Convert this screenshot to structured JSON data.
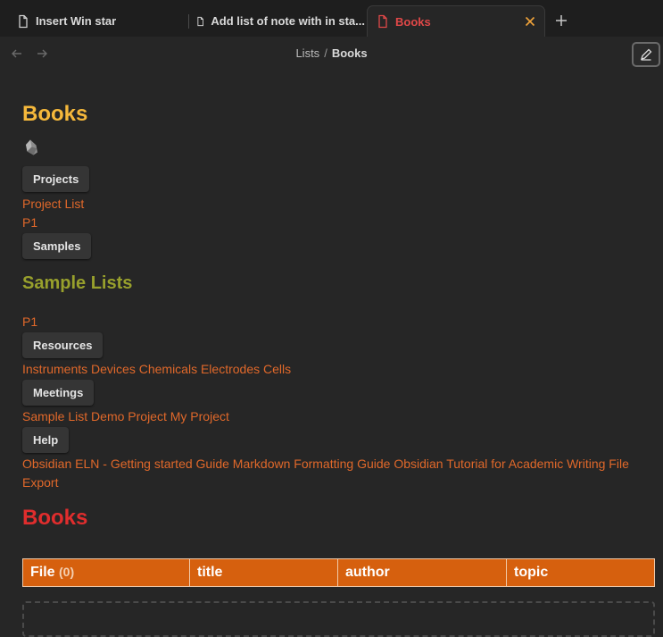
{
  "tabs": [
    {
      "label": "Insert Win star",
      "active": false
    },
    {
      "label": "Add list of note with in sta...",
      "active": false
    },
    {
      "label": "Books",
      "active": true
    }
  ],
  "breadcrumb": {
    "parent": "Lists",
    "separator": "/",
    "current": "Books"
  },
  "note": {
    "title": "Books",
    "projects_button": "Projects",
    "project_links": [
      "Project List",
      "P1"
    ],
    "samples_button": "Samples",
    "sample_lists_heading": "Sample Lists",
    "sample_links": [
      "P1"
    ],
    "resources_button": "Resources",
    "resource_links": [
      "Instruments",
      "Devices",
      "Chemicals",
      "Electrodes",
      "Cells"
    ],
    "meetings_button": "Meetings",
    "meeting_links": [
      "Sample List",
      "Demo Project",
      "My Project"
    ],
    "help_button": "Help",
    "help_links": [
      "Obsidian ELN - Getting started Guide",
      "Markdown Formatting Guide",
      "Obsidian Tutorial for Academic Writing",
      "File Export"
    ],
    "books_heading": "Books",
    "table": {
      "columns": [
        "File",
        "title",
        "author",
        "topic"
      ],
      "file_count": "(0)"
    }
  },
  "colors": {
    "accent_link": "#e0682a",
    "heading_books": "#f5b83b",
    "heading_sample_lists": "#98a02c",
    "heading_books_red": "#e02d2d",
    "table_header": "#d6600e",
    "active_tab": "#e04848"
  }
}
